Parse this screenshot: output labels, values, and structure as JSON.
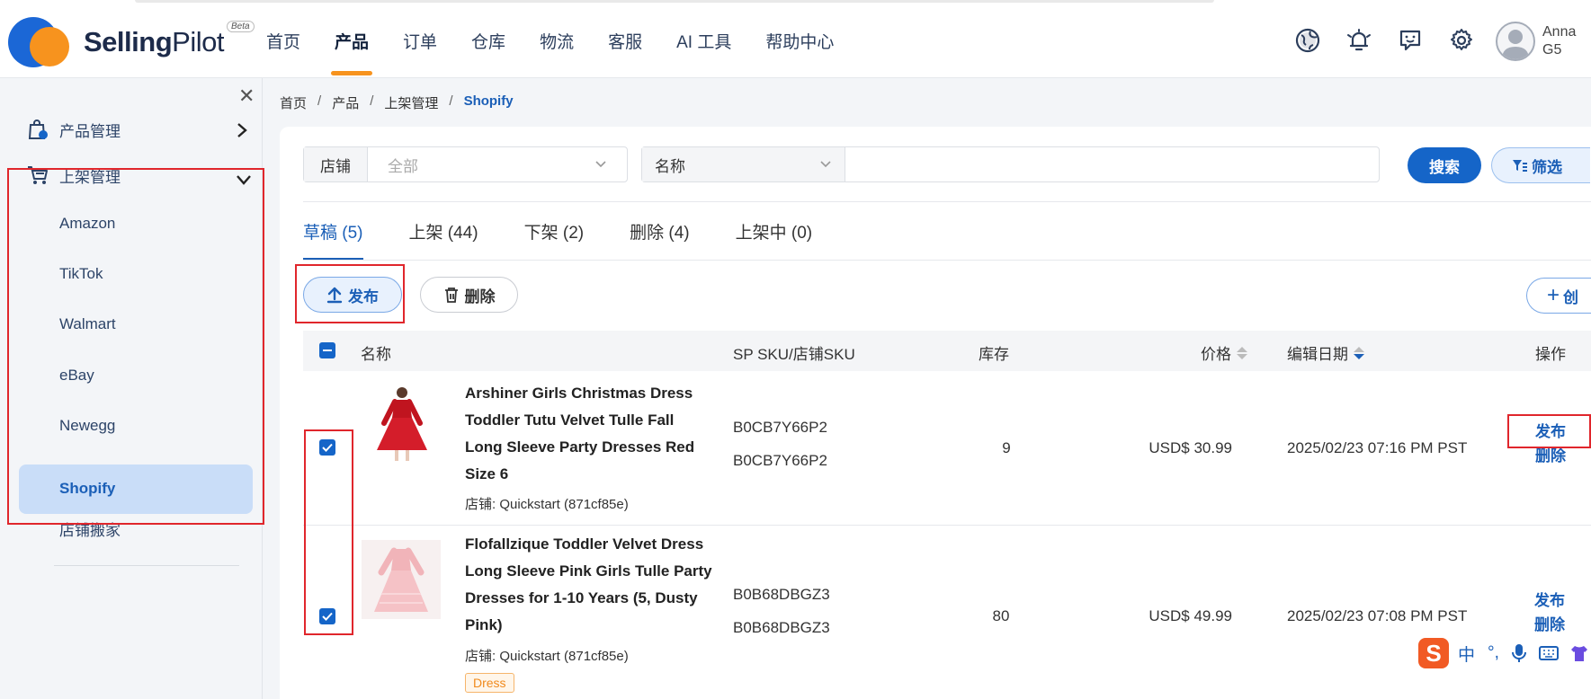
{
  "app": {
    "brand_bold": "Selling",
    "brand_light": "Pilot",
    "beta": "Beta"
  },
  "nav": [
    "首页",
    "产品",
    "订单",
    "仓库",
    "物流",
    "客服",
    "AI 工具",
    "帮助中心"
  ],
  "nav_active": "产品",
  "user": {
    "line1": "Anna",
    "line2": "G5"
  },
  "top_icons": [
    "globe-icon",
    "bell-icon",
    "message-icon",
    "gear-icon"
  ],
  "sidebar": {
    "group1": "产品管理",
    "group2": "上架管理",
    "items": [
      "Amazon",
      "TikTok",
      "Walmart",
      "eBay",
      "Newegg",
      "Shopify"
    ],
    "active": "Shopify",
    "extra": "店铺搬家"
  },
  "breadcrumb": [
    "首页",
    "产品",
    "上架管理",
    "Shopify"
  ],
  "filter": {
    "store_label": "店铺",
    "store_placeholder": "全部",
    "field_select": "名称",
    "search_button": "搜索",
    "filter_button": "筛选"
  },
  "tabs": [
    "草稿 (5)",
    "上架 (44)",
    "下架 (2)",
    "删除 (4)",
    "上架中 (0)"
  ],
  "tab_active": "草稿 (5)",
  "actions": {
    "publish": "发布",
    "delete": "删除",
    "create": "创"
  },
  "table": {
    "headers": {
      "name": "名称",
      "sku": "SP SKU/店铺SKU",
      "stock": "库存",
      "price": "价格",
      "date": "编辑日期",
      "ops": "操作"
    },
    "rows": [
      {
        "name": "Arshiner Girls Christmas Dress Toddler Tutu Velvet Tulle Fall Long Sleeve Party Dresses Red Size 6",
        "store": "店铺: Quickstart (871cf85e)",
        "sku1": "B0CB7Y66P2",
        "sku2": "B0CB7Y66P2",
        "stock": "9",
        "price": "USD$ 30.99",
        "date": "2025/02/23 07:16 PM PST",
        "op1": "发布",
        "op2": "删除",
        "tag": ""
      },
      {
        "name": "Flofallzique Toddler Velvet Dress Long Sleeve Pink Girls Tulle Party Dresses for 1-10 Years (5, Dusty Pink)",
        "store": "店铺: Quickstart (871cf85e)",
        "sku1": "B0B68DBGZ3",
        "sku2": "B0B68DBGZ3",
        "stock": "80",
        "price": "USD$ 49.99",
        "date": "2025/02/23 07:08 PM PST",
        "op1": "发布",
        "op2": "删除",
        "tag": "Dress"
      }
    ]
  },
  "ime": {
    "logo": "S",
    "lang": "中"
  },
  "colors": {
    "primary": "#1565c8",
    "accent": "#f7931e",
    "highlight": "#e0262c"
  }
}
